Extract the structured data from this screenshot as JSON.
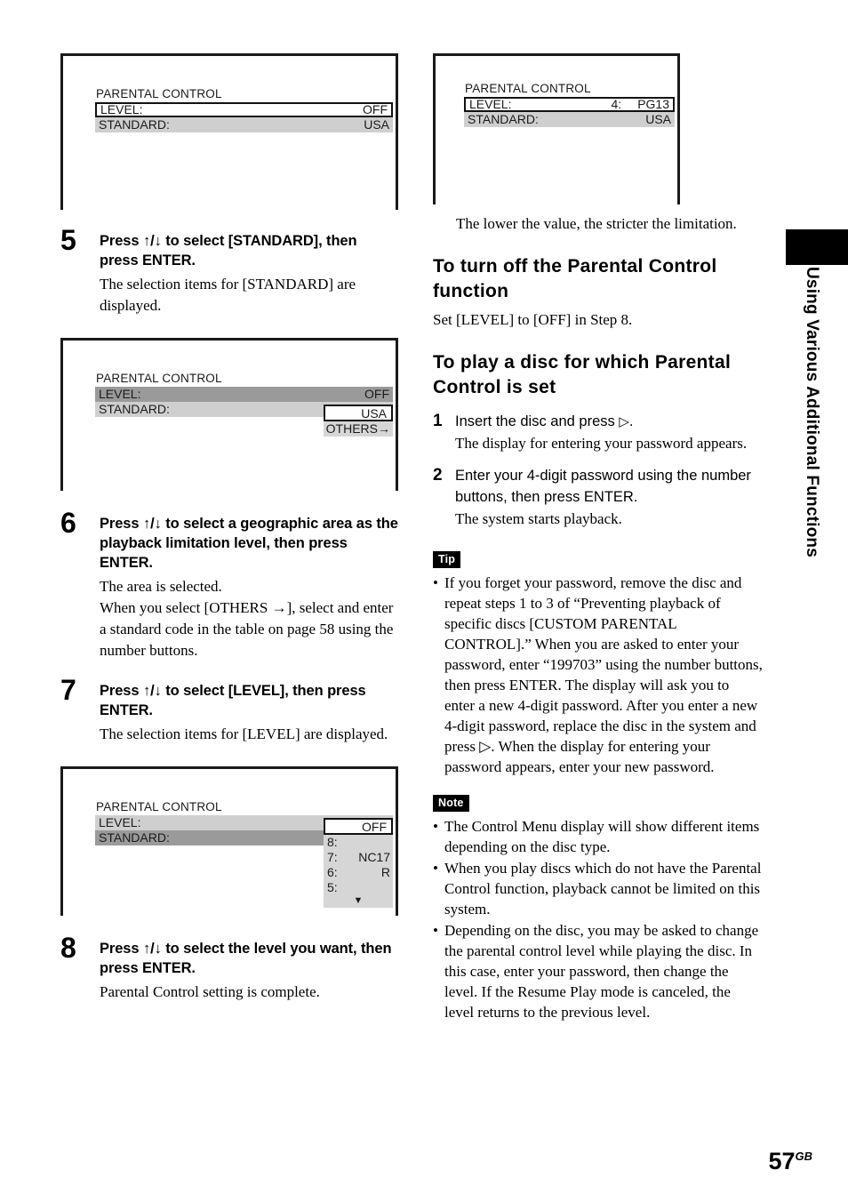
{
  "page": {
    "number": "57",
    "number_suffix": "GB",
    "thumb_tab_label": "Using Various Additional Functions"
  },
  "figures": {
    "fig1": {
      "title": "PARENTAL CONTROL",
      "rows": [
        {
          "label": "LEVEL:",
          "mid": "",
          "value": "OFF",
          "style": "boxed"
        },
        {
          "label": "STANDARD:",
          "mid": "",
          "value": "USA",
          "style": "light"
        }
      ]
    },
    "fig2": {
      "title": "PARENTAL CONTROL",
      "rows": [
        {
          "label": "LEVEL:",
          "mid": "",
          "value": "OFF",
          "style": "dark"
        },
        {
          "label": "STANDARD:",
          "mid": "",
          "value": "USA",
          "style": "light"
        }
      ],
      "dropdown": {
        "selected": "USA",
        "items": [
          {
            "num": "",
            "text": "OTHERS→"
          }
        ]
      }
    },
    "fig3": {
      "title": "PARENTAL CONTROL",
      "rows": [
        {
          "label": "LEVEL:",
          "mid": "",
          "value": "OFF",
          "style": "light"
        },
        {
          "label": "STANDARD:",
          "mid": "",
          "value": "",
          "style": "dark"
        }
      ],
      "dropdown": {
        "selected": "OFF",
        "items": [
          {
            "num": "8:",
            "text": ""
          },
          {
            "num": "7:",
            "text": "NC17"
          },
          {
            "num": "6:",
            "text": "R"
          },
          {
            "num": "5:",
            "text": ""
          }
        ],
        "more_arrow": "▼"
      }
    },
    "fig4": {
      "title": "PARENTAL CONTROL",
      "rows": [
        {
          "label": "LEVEL:",
          "mid": "4:",
          "value": "PG13",
          "style": "boxed"
        },
        {
          "label": "STANDARD:",
          "mid": "",
          "value": "USA",
          "style": "light"
        }
      ]
    }
  },
  "left_column": {
    "steps": [
      {
        "num": "5",
        "head": "Press ↑/↓ to select [STANDARD], then press ENTER.",
        "body": [
          "The selection items for [STANDARD] are displayed."
        ]
      },
      {
        "num": "6",
        "head": "Press ↑/↓ to select a geographic area as the playback limitation level, then press ENTER.",
        "body": [
          "The area is selected.",
          "When you select [OTHERS →], select and enter a standard code in the table on page 58 using the number buttons."
        ]
      },
      {
        "num": "7",
        "head": "Press ↑/↓ to select [LEVEL], then press ENTER.",
        "body": [
          "The selection items for [LEVEL] are displayed."
        ]
      },
      {
        "num": "8",
        "head": "Press ↑/↓ to select the level you want, then press ENTER.",
        "body": [
          "Parental Control setting is complete."
        ]
      }
    ]
  },
  "right_column": {
    "intro": "The lower the value, the stricter the limitation.",
    "section1": {
      "heading": "To turn off the Parental Control function",
      "body": "Set [LEVEL] to [OFF] in Step 8."
    },
    "section2": {
      "heading": "To play a disc for which Parental Control is set",
      "steps": [
        {
          "num": "1",
          "head_before": "Insert the disc and press ",
          "head_icon": "▷",
          "head_after": ".",
          "body": "The display for entering your password appears."
        },
        {
          "num": "2",
          "head_before": "Enter your 4-digit password using the number buttons, then press ENTER.",
          "head_icon": "",
          "head_after": "",
          "body": "The system starts playback."
        }
      ]
    },
    "tip": {
      "label": "Tip",
      "items": [
        "If you forget your password, remove the disc and repeat steps 1 to 3 of “Preventing playback of specific discs [CUSTOM PARENTAL CONTROL].” When you are asked to enter your password, enter “199703” using the number buttons, then press ENTER. The display will ask you to enter a new 4-digit password. After you enter a new 4-digit password, replace the disc in the system and press ▷. When the display for entering your password appears, enter your new password."
      ]
    },
    "note": {
      "label": "Note",
      "items": [
        "The Control Menu display will show different items depending on the disc type.",
        "When you play discs which do not have the Parental Control function, playback cannot be limited on this system.",
        "Depending on the disc, you may be asked to change the parental control level while playing the disc. In this case, enter your password, then change the level. If the Resume Play mode is canceled, the level returns to the previous level."
      ]
    }
  },
  "colors": {
    "ink": "#1a1a1a",
    "row_light": "#cfcfcf",
    "row_dark": "#9a9a9a",
    "list_bg": "#d6d6d6"
  }
}
